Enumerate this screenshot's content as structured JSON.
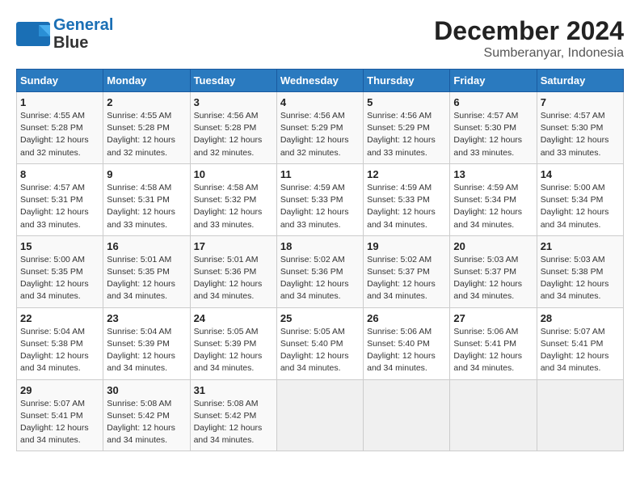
{
  "header": {
    "logo_line1": "General",
    "logo_line2": "Blue",
    "title": "December 2024",
    "subtitle": "Sumberanyar, Indonesia"
  },
  "weekdays": [
    "Sunday",
    "Monday",
    "Tuesday",
    "Wednesday",
    "Thursday",
    "Friday",
    "Saturday"
  ],
  "weeks": [
    [
      {
        "day": "1",
        "info": "Sunrise: 4:55 AM\nSunset: 5:28 PM\nDaylight: 12 hours\nand 32 minutes."
      },
      {
        "day": "2",
        "info": "Sunrise: 4:55 AM\nSunset: 5:28 PM\nDaylight: 12 hours\nand 32 minutes."
      },
      {
        "day": "3",
        "info": "Sunrise: 4:56 AM\nSunset: 5:28 PM\nDaylight: 12 hours\nand 32 minutes."
      },
      {
        "day": "4",
        "info": "Sunrise: 4:56 AM\nSunset: 5:29 PM\nDaylight: 12 hours\nand 32 minutes."
      },
      {
        "day": "5",
        "info": "Sunrise: 4:56 AM\nSunset: 5:29 PM\nDaylight: 12 hours\nand 33 minutes."
      },
      {
        "day": "6",
        "info": "Sunrise: 4:57 AM\nSunset: 5:30 PM\nDaylight: 12 hours\nand 33 minutes."
      },
      {
        "day": "7",
        "info": "Sunrise: 4:57 AM\nSunset: 5:30 PM\nDaylight: 12 hours\nand 33 minutes."
      }
    ],
    [
      {
        "day": "8",
        "info": "Sunrise: 4:57 AM\nSunset: 5:31 PM\nDaylight: 12 hours\nand 33 minutes."
      },
      {
        "day": "9",
        "info": "Sunrise: 4:58 AM\nSunset: 5:31 PM\nDaylight: 12 hours\nand 33 minutes."
      },
      {
        "day": "10",
        "info": "Sunrise: 4:58 AM\nSunset: 5:32 PM\nDaylight: 12 hours\nand 33 minutes."
      },
      {
        "day": "11",
        "info": "Sunrise: 4:59 AM\nSunset: 5:33 PM\nDaylight: 12 hours\nand 33 minutes."
      },
      {
        "day": "12",
        "info": "Sunrise: 4:59 AM\nSunset: 5:33 PM\nDaylight: 12 hours\nand 34 minutes."
      },
      {
        "day": "13",
        "info": "Sunrise: 4:59 AM\nSunset: 5:34 PM\nDaylight: 12 hours\nand 34 minutes."
      },
      {
        "day": "14",
        "info": "Sunrise: 5:00 AM\nSunset: 5:34 PM\nDaylight: 12 hours\nand 34 minutes."
      }
    ],
    [
      {
        "day": "15",
        "info": "Sunrise: 5:00 AM\nSunset: 5:35 PM\nDaylight: 12 hours\nand 34 minutes."
      },
      {
        "day": "16",
        "info": "Sunrise: 5:01 AM\nSunset: 5:35 PM\nDaylight: 12 hours\nand 34 minutes."
      },
      {
        "day": "17",
        "info": "Sunrise: 5:01 AM\nSunset: 5:36 PM\nDaylight: 12 hours\nand 34 minutes."
      },
      {
        "day": "18",
        "info": "Sunrise: 5:02 AM\nSunset: 5:36 PM\nDaylight: 12 hours\nand 34 minutes."
      },
      {
        "day": "19",
        "info": "Sunrise: 5:02 AM\nSunset: 5:37 PM\nDaylight: 12 hours\nand 34 minutes."
      },
      {
        "day": "20",
        "info": "Sunrise: 5:03 AM\nSunset: 5:37 PM\nDaylight: 12 hours\nand 34 minutes."
      },
      {
        "day": "21",
        "info": "Sunrise: 5:03 AM\nSunset: 5:38 PM\nDaylight: 12 hours\nand 34 minutes."
      }
    ],
    [
      {
        "day": "22",
        "info": "Sunrise: 5:04 AM\nSunset: 5:38 PM\nDaylight: 12 hours\nand 34 minutes."
      },
      {
        "day": "23",
        "info": "Sunrise: 5:04 AM\nSunset: 5:39 PM\nDaylight: 12 hours\nand 34 minutes."
      },
      {
        "day": "24",
        "info": "Sunrise: 5:05 AM\nSunset: 5:39 PM\nDaylight: 12 hours\nand 34 minutes."
      },
      {
        "day": "25",
        "info": "Sunrise: 5:05 AM\nSunset: 5:40 PM\nDaylight: 12 hours\nand 34 minutes."
      },
      {
        "day": "26",
        "info": "Sunrise: 5:06 AM\nSunset: 5:40 PM\nDaylight: 12 hours\nand 34 minutes."
      },
      {
        "day": "27",
        "info": "Sunrise: 5:06 AM\nSunset: 5:41 PM\nDaylight: 12 hours\nand 34 minutes."
      },
      {
        "day": "28",
        "info": "Sunrise: 5:07 AM\nSunset: 5:41 PM\nDaylight: 12 hours\nand 34 minutes."
      }
    ],
    [
      {
        "day": "29",
        "info": "Sunrise: 5:07 AM\nSunset: 5:41 PM\nDaylight: 12 hours\nand 34 minutes."
      },
      {
        "day": "30",
        "info": "Sunrise: 5:08 AM\nSunset: 5:42 PM\nDaylight: 12 hours\nand 34 minutes."
      },
      {
        "day": "31",
        "info": "Sunrise: 5:08 AM\nSunset: 5:42 PM\nDaylight: 12 hours\nand 34 minutes."
      },
      {
        "day": "",
        "info": ""
      },
      {
        "day": "",
        "info": ""
      },
      {
        "day": "",
        "info": ""
      },
      {
        "day": "",
        "info": ""
      }
    ]
  ]
}
